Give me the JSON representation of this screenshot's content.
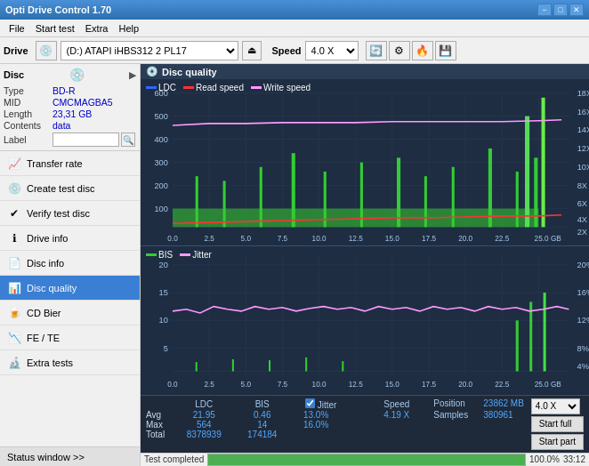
{
  "app": {
    "title": "Opti Drive Control 1.70",
    "title_icon": "💿"
  },
  "title_bar": {
    "minimize": "−",
    "maximize": "□",
    "close": "✕"
  },
  "menu": {
    "items": [
      "File",
      "Start test",
      "Extra",
      "Help"
    ]
  },
  "drive_bar": {
    "drive_label": "Drive",
    "drive_value": "(D:)  ATAPI iHBS312  2 PL17",
    "speed_label": "Speed",
    "speed_value": "4.0 X"
  },
  "disc": {
    "title": "Disc",
    "type_label": "Type",
    "type_value": "BD-R",
    "mid_label": "MID",
    "mid_value": "CMCMAGBA5",
    "length_label": "Length",
    "length_value": "23,31 GB",
    "contents_label": "Contents",
    "contents_value": "data",
    "label_label": "Label",
    "label_value": ""
  },
  "nav": {
    "items": [
      {
        "id": "transfer-rate",
        "label": "Transfer rate",
        "icon": "📈"
      },
      {
        "id": "create-test-disc",
        "label": "Create test disc",
        "icon": "💿"
      },
      {
        "id": "verify-test-disc",
        "label": "Verify test disc",
        "icon": "✔"
      },
      {
        "id": "drive-info",
        "label": "Drive info",
        "icon": "ℹ"
      },
      {
        "id": "disc-info",
        "label": "Disc info",
        "icon": "📄"
      },
      {
        "id": "disc-quality",
        "label": "Disc quality",
        "icon": "📊",
        "active": true
      },
      {
        "id": "cd-bier",
        "label": "CD Bier",
        "icon": "🍺"
      },
      {
        "id": "fe-te",
        "label": "FE / TE",
        "icon": "📉"
      },
      {
        "id": "extra-tests",
        "label": "Extra tests",
        "icon": "🔬"
      }
    ]
  },
  "sidebar_status": {
    "label": "Status window >>",
    "arrow": ">>"
  },
  "chart": {
    "title": "Disc quality",
    "icon": "💿",
    "top_legend": [
      {
        "color": "#3366ff",
        "label": "LDC"
      },
      {
        "color": "#ff3333",
        "label": "Read speed"
      },
      {
        "color": "#ff99ff",
        "label": "Write speed"
      }
    ],
    "bottom_legend": [
      {
        "color": "#33cc33",
        "label": "BIS"
      },
      {
        "color": "#ff99ff",
        "label": "Jitter"
      }
    ],
    "top_y_left": [
      "600",
      "500",
      "400",
      "300",
      "200",
      "100"
    ],
    "top_y_right": [
      "18X",
      "16X",
      "14X",
      "12X",
      "10X",
      "8X",
      "6X",
      "4X",
      "2X"
    ],
    "bottom_y_left": [
      "20",
      "15",
      "10",
      "5"
    ],
    "bottom_y_right": [
      "20%",
      "16%",
      "12%",
      "8%",
      "4%"
    ],
    "x_labels": [
      "0.0",
      "2.5",
      "5.0",
      "7.5",
      "10.0",
      "12.5",
      "15.0",
      "17.5",
      "20.0",
      "22.5",
      "25.0 GB"
    ]
  },
  "stats": {
    "headers": [
      "LDC",
      "BIS",
      "",
      "Jitter",
      "Speed"
    ],
    "avg_label": "Avg",
    "avg_ldc": "21.95",
    "avg_bis": "0.46",
    "avg_jitter": "13.0%",
    "avg_speed": "4.19 X",
    "max_label": "Max",
    "max_ldc": "564",
    "max_bis": "14",
    "max_jitter": "16.0%",
    "total_label": "Total",
    "total_ldc": "8378939",
    "total_bis": "174184",
    "position_label": "Position",
    "position_value": "23862 MB",
    "samples_label": "Samples",
    "samples_value": "380961",
    "jitter_checked": true,
    "speed_select": "4.0 X",
    "start_full": "Start full",
    "start_part": "Start part"
  },
  "bottom_bar": {
    "status": "Test completed",
    "progress": 100,
    "time": "33:12"
  }
}
